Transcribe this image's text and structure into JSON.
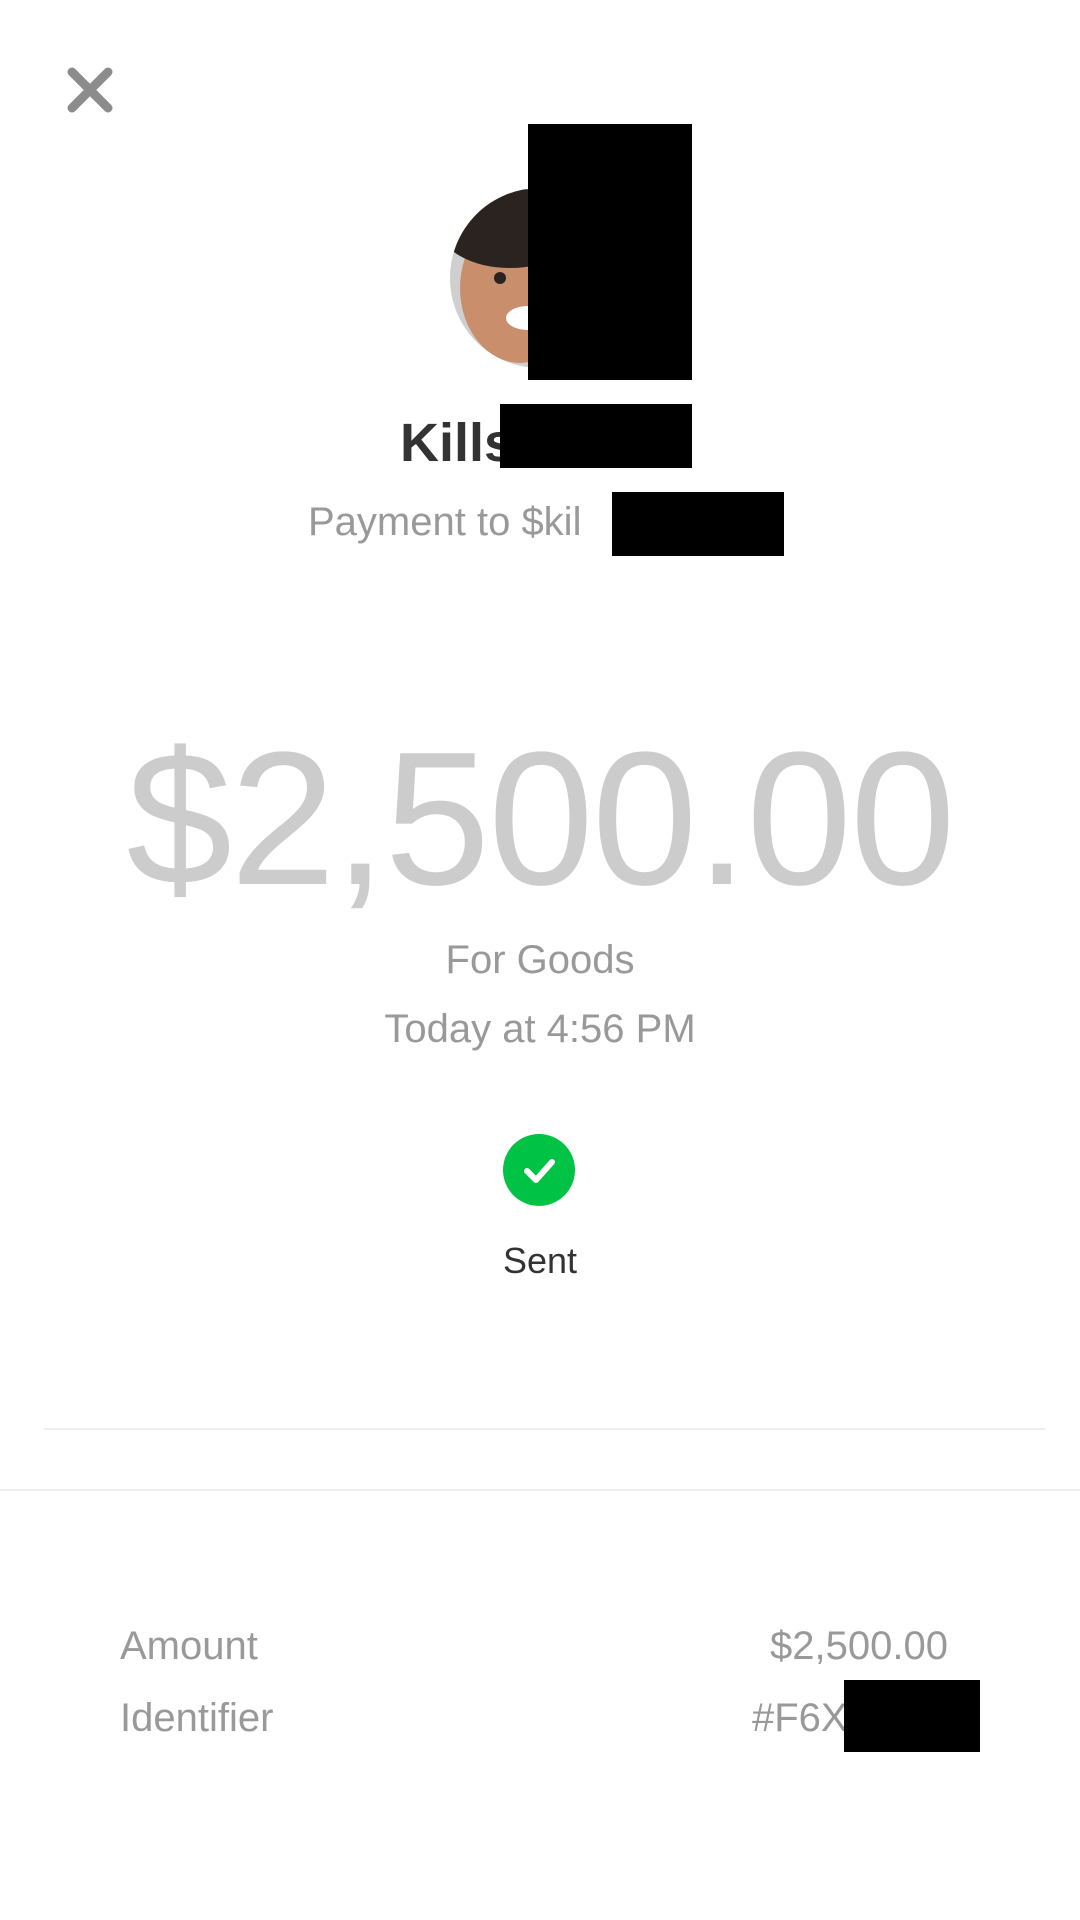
{
  "header": {
    "close_icon": "close-icon"
  },
  "recipient": {
    "name_visible": "Kills",
    "subtitle_visible": "Payment to $kil",
    "avatar": "avatar-photo"
  },
  "payment": {
    "amount": "$2,500.00",
    "note": "For Goods",
    "time": "Today at 4:56 PM"
  },
  "status": {
    "label": "Sent",
    "icon": "check-circle-icon",
    "color": "#00c244"
  },
  "details": {
    "amount_label": "Amount",
    "amount_value": "$2,500.00",
    "identifier_label": "Identifier",
    "identifier_value_visible": "#F6X"
  },
  "colors": {
    "amount_text": "#cccccc",
    "secondary_text": "#999999",
    "primary_text": "#333333",
    "redaction": "#000000"
  }
}
